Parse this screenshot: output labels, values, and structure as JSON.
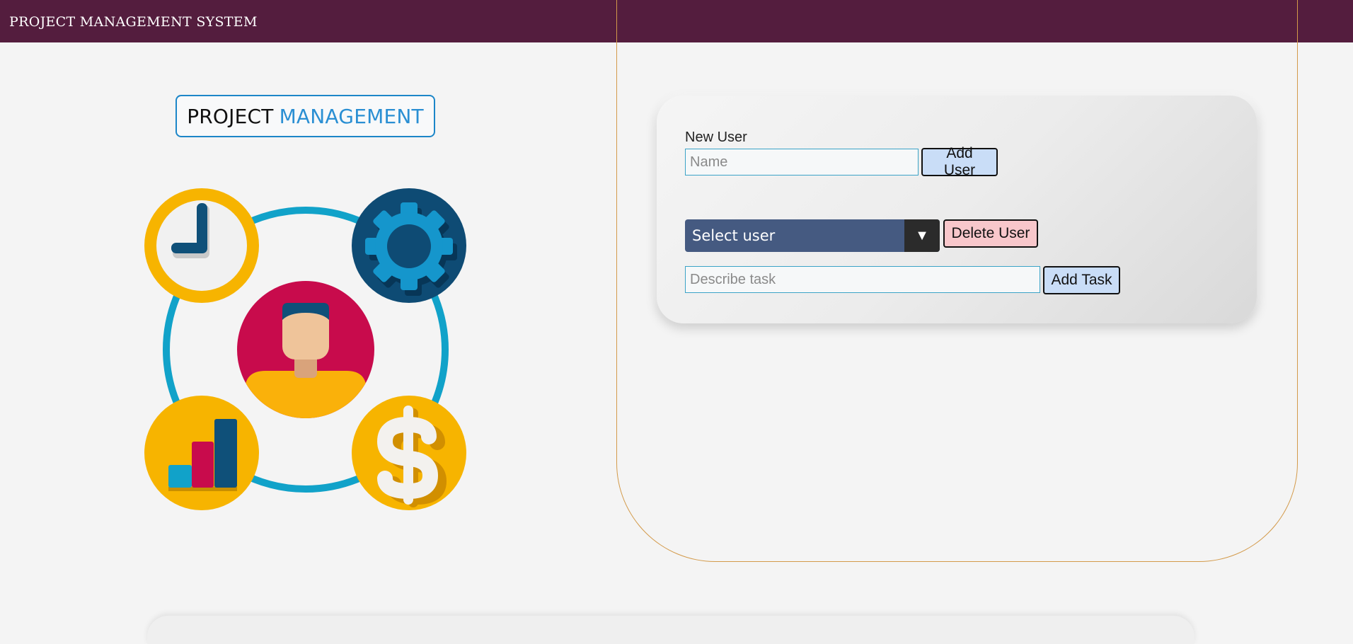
{
  "header": {
    "title": "PROJECT MANAGEMENT SYSTEM",
    "background": "#541d3e"
  },
  "logo": {
    "word_1": "PROJECT",
    "word_2": "MANAGEMENT",
    "accent": "#2a8fd3"
  },
  "illustration": {
    "icons": [
      "clock-icon",
      "gear-icon",
      "user-avatar-icon",
      "bar-chart-icon",
      "dollar-icon"
    ]
  },
  "form": {
    "new_user_label": "New User",
    "name_placeholder": "Name",
    "add_user_label": "Add User",
    "select_value": "Select user",
    "select_arrow": "▼",
    "delete_user_label": "Delete User",
    "task_placeholder": "Describe task",
    "add_task_label": "Add Task"
  },
  "colors": {
    "add_button": "#c9ddf7",
    "delete_button": "#f8c7cb",
    "select_bg": "#455a81",
    "panel_outline": "#d39a4a"
  }
}
